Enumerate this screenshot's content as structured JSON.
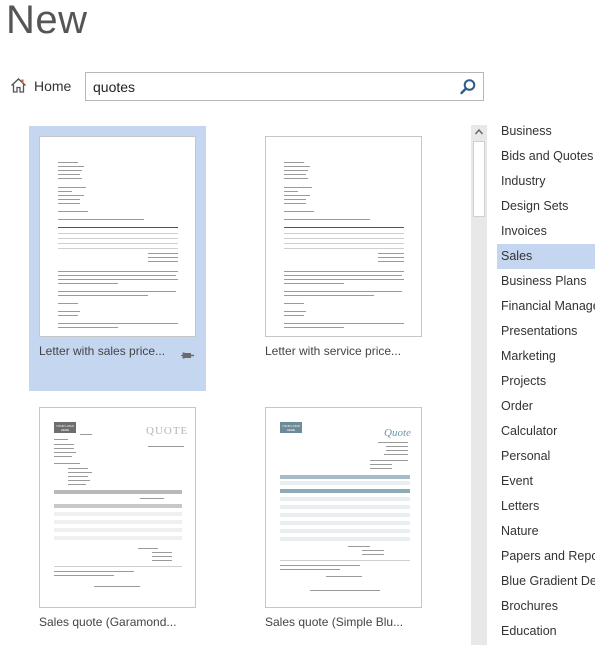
{
  "page": {
    "title": "New"
  },
  "nav": {
    "home_label": "Home"
  },
  "search": {
    "value": "quotes"
  },
  "templates": [
    {
      "label": "Letter with sales price..."
    },
    {
      "label": "Letter with service price..."
    },
    {
      "label": "Sales quote (Garamond..."
    },
    {
      "label": "Sales quote (Simple Blu..."
    }
  ],
  "thumb_text": {
    "quote_caps": "QUOTE",
    "quote_italic": "Quote",
    "logo_text": "YOUR LOGO HERE"
  },
  "categories": [
    {
      "label": "Business"
    },
    {
      "label": "Bids and Quotes"
    },
    {
      "label": "Industry"
    },
    {
      "label": "Design Sets"
    },
    {
      "label": "Invoices"
    },
    {
      "label": "Sales"
    },
    {
      "label": "Business Plans"
    },
    {
      "label": "Financial Manage"
    },
    {
      "label": "Presentations"
    },
    {
      "label": "Marketing"
    },
    {
      "label": "Projects"
    },
    {
      "label": "Order"
    },
    {
      "label": "Calculator"
    },
    {
      "label": "Personal"
    },
    {
      "label": "Event"
    },
    {
      "label": "Letters"
    },
    {
      "label": "Nature"
    },
    {
      "label": "Papers and Report"
    },
    {
      "label": "Blue Gradient Des"
    },
    {
      "label": "Brochures"
    },
    {
      "label": "Education"
    }
  ],
  "selection": {
    "template_index": 0,
    "category": "Sales"
  },
  "colors": {
    "selection": "#c5d6f0",
    "search_icon": "#2e5c8a",
    "home_icon": "#c8602c"
  },
  "icons": {
    "home": "home-icon",
    "search": "search-icon",
    "pin": "pin-icon"
  }
}
